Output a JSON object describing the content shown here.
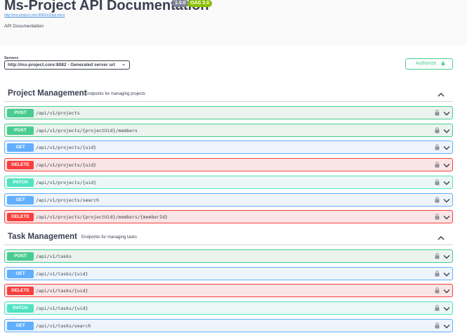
{
  "info": {
    "title": "Ms-Project API Documentation",
    "version": "1.0.0",
    "oas": "OAS 3.0",
    "spec_url": "http://ms-project.core:8082/v3/api-docs",
    "description": "API Documentation"
  },
  "servers": {
    "label": "Servers",
    "selected": "http://ms-project.core:8082 - Generated server url"
  },
  "authorize": {
    "label": "Authorize"
  },
  "tags": [
    {
      "name": "Project Management",
      "description": "Endpoints for managing projects",
      "operations": [
        {
          "method": "POST",
          "path": "/api/v1/projects"
        },
        {
          "method": "POST",
          "path": "/api/v1/projects/{projectUid}/members"
        },
        {
          "method": "GET",
          "path": "/api/v1/projects/{uid}"
        },
        {
          "method": "DELETE",
          "path": "/api/v1/projects/{uid}"
        },
        {
          "method": "PATCH",
          "path": "/api/v1/projects/{uid}"
        },
        {
          "method": "GET",
          "path": "/api/v1/projects/search"
        },
        {
          "method": "DELETE",
          "path": "/api/v1/projects/{projectUid}/members/{memberId}"
        }
      ]
    },
    {
      "name": "Task Management",
      "description": "Endpoints for managing tasks",
      "operations": [
        {
          "method": "POST",
          "path": "/api/v1/tasks"
        },
        {
          "method": "GET",
          "path": "/api/v1/tasks/{uid}"
        },
        {
          "method": "DELETE",
          "path": "/api/v1/tasks/{uid}"
        },
        {
          "method": "PATCH",
          "path": "/api/v1/tasks/{uid}"
        },
        {
          "method": "GET",
          "path": "/api/v1/tasks/search"
        }
      ]
    }
  ],
  "colors": {
    "post": "#49cc90",
    "get": "#61affe",
    "delete": "#f93e3e",
    "patch": "#50e3c2"
  }
}
